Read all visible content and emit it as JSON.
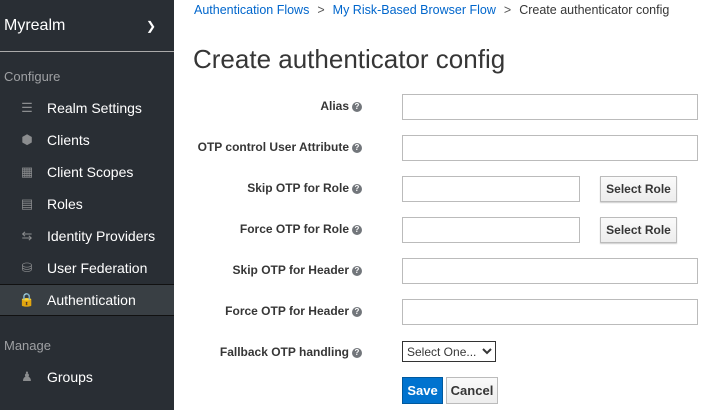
{
  "sidebar": {
    "realm": "Myrealm",
    "configure_label": "Configure",
    "manage_label": "Manage",
    "configure_items": [
      {
        "label": "Realm Settings",
        "icon": "sliders-icon"
      },
      {
        "label": "Clients",
        "icon": "cube-icon"
      },
      {
        "label": "Client Scopes",
        "icon": "cubes-icon"
      },
      {
        "label": "Roles",
        "icon": "list-icon"
      },
      {
        "label": "Identity Providers",
        "icon": "exchange-icon"
      },
      {
        "label": "User Federation",
        "icon": "database-icon"
      },
      {
        "label": "Authentication",
        "icon": "lock-icon",
        "active": true
      }
    ],
    "manage_items": [
      {
        "label": "Groups",
        "icon": "users-icon"
      }
    ]
  },
  "breadcrumb": [
    "Authentication Flows",
    "My Risk-Based Browser Flow",
    "Create authenticator config"
  ],
  "title": "Create authenticator config",
  "form": {
    "alias": "Alias",
    "otp_attr": "OTP control User Attribute",
    "skip_role": "Skip OTP for Role",
    "force_role": "Force OTP for Role",
    "skip_header": "Skip OTP for Header",
    "force_header": "Force OTP for Header",
    "fallback": "Fallback OTP handling",
    "select_role": "Select Role",
    "fallback_value": "Select One...",
    "save": "Save",
    "cancel": "Cancel"
  },
  "colors": {
    "sidebar": "#292e34",
    "accent": "#0073cf",
    "link": "#0066cc"
  }
}
